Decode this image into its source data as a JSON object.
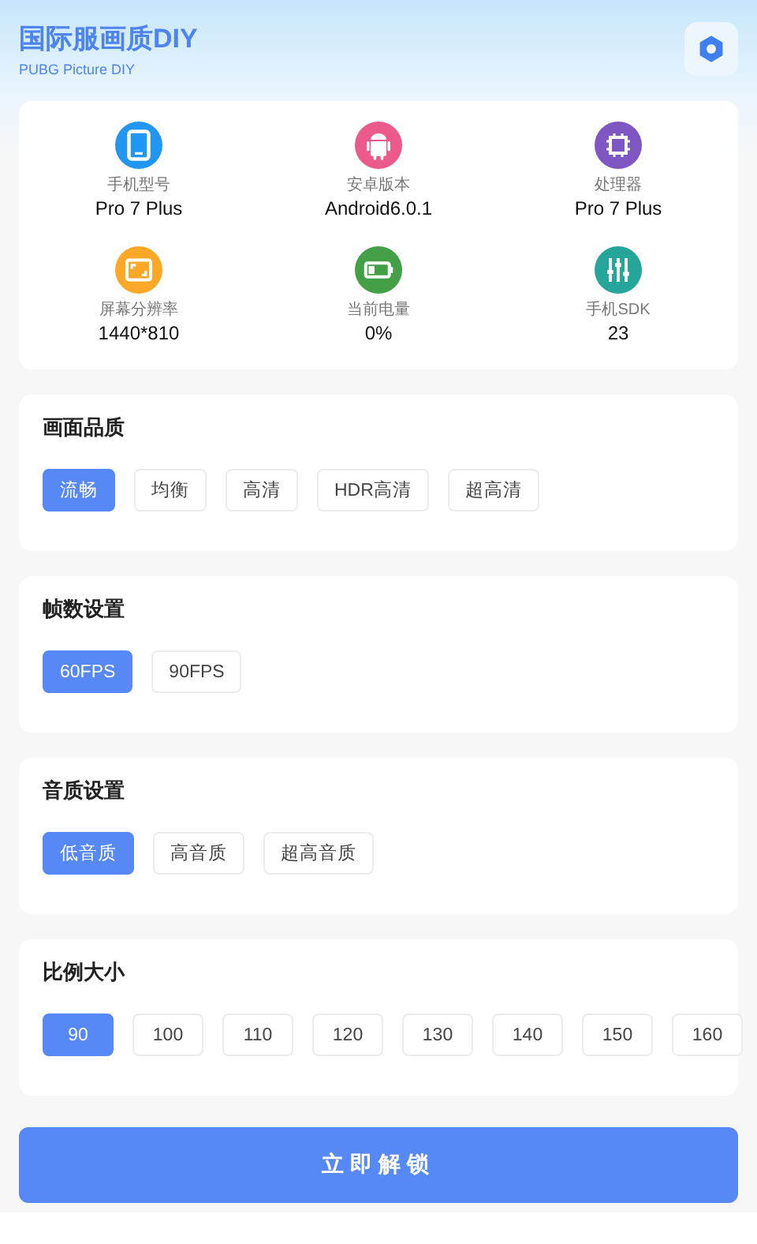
{
  "header": {
    "title": "国际服画质DIY",
    "subtitle": "PUBG Picture DIY"
  },
  "device_info": [
    {
      "kind": "phone",
      "label": "手机型号",
      "value": "Pro 7 Plus",
      "color": "#2196f3"
    },
    {
      "kind": "android",
      "label": "安卓版本",
      "value": "Android6.0.1",
      "color": "#ec5a8c"
    },
    {
      "kind": "chip",
      "label": "处理器",
      "value": "Pro 7 Plus",
      "color": "#7e57c2"
    },
    {
      "kind": "screen",
      "label": "屏幕分辨率",
      "value": "1440*810",
      "color": "#ffa726"
    },
    {
      "kind": "battery",
      "label": "当前电量",
      "value": "0%",
      "color": "#43a047"
    },
    {
      "kind": "sliders",
      "label": "手机SDK",
      "value": "23",
      "color": "#26a69a"
    }
  ],
  "sections": [
    {
      "title": "画面品质",
      "options": [
        {
          "label": "流畅",
          "selected": true
        },
        {
          "label": "均衡",
          "selected": false
        },
        {
          "label": "高清",
          "selected": false
        },
        {
          "label": "HDR高清",
          "selected": false
        },
        {
          "label": "超高清",
          "selected": false
        }
      ]
    },
    {
      "title": "帧数设置",
      "options": [
        {
          "label": "60FPS",
          "selected": true
        },
        {
          "label": "90FPS",
          "selected": false
        }
      ]
    },
    {
      "title": "音质设置",
      "options": [
        {
          "label": "低音质",
          "selected": true
        },
        {
          "label": "高音质",
          "selected": false
        },
        {
          "label": "超高音质",
          "selected": false
        }
      ]
    },
    {
      "title": "比例大小",
      "options": [
        {
          "label": "90",
          "selected": true
        },
        {
          "label": "100",
          "selected": false
        },
        {
          "label": "110",
          "selected": false
        },
        {
          "label": "120",
          "selected": false
        },
        {
          "label": "130",
          "selected": false
        },
        {
          "label": "140",
          "selected": false
        },
        {
          "label": "150",
          "selected": false
        },
        {
          "label": "160",
          "selected": false
        }
      ]
    }
  ],
  "unlock_button": "立即解锁"
}
